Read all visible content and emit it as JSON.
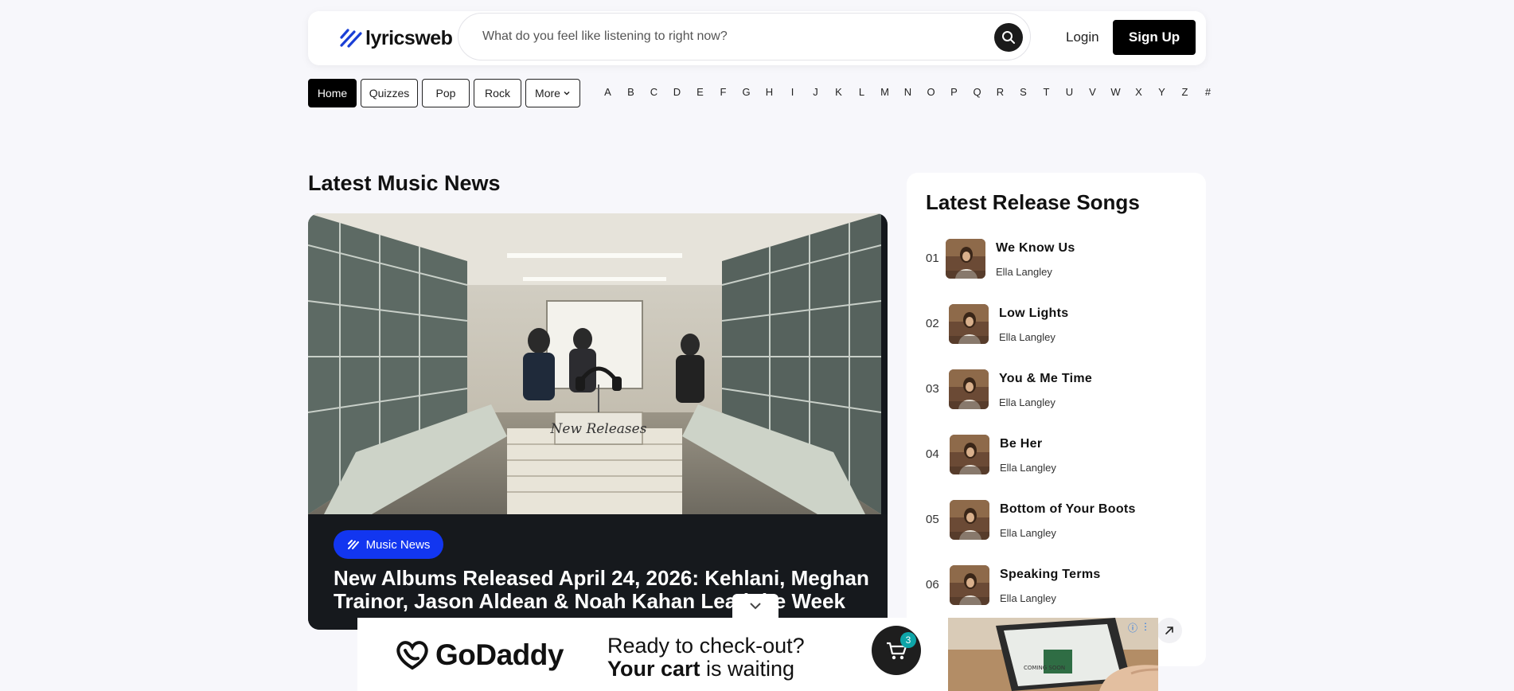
{
  "header": {
    "logo_text": "lyricsweb",
    "search_placeholder": "What do you feel like listening to right now?",
    "login_label": "Login",
    "signup_label": "Sign Up"
  },
  "nav": {
    "buttons": [
      {
        "label": "Home",
        "active": true
      },
      {
        "label": "Quizzes",
        "active": false
      },
      {
        "label": "Pop",
        "active": false
      },
      {
        "label": "Rock",
        "active": false
      },
      {
        "label": "More",
        "active": false
      }
    ],
    "alphabet": [
      "A",
      "B",
      "C",
      "D",
      "E",
      "F",
      "G",
      "H",
      "I",
      "J",
      "K",
      "L",
      "M",
      "N",
      "O",
      "P",
      "Q",
      "R",
      "S",
      "T",
      "U",
      "V",
      "W",
      "X",
      "Y",
      "Z",
      "#"
    ]
  },
  "news": {
    "section_title": "Latest Music News",
    "image_sign": "New Releases",
    "category": "Music News",
    "headline": "New Albums Released April 24, 2026: Kehlani, Meghan Trainor, Jason Aldean & Noah Kahan Lead the Week"
  },
  "songs": {
    "section_title": "Latest Release Songs",
    "items": [
      {
        "num": "01",
        "title": "We Know Us",
        "artist": "Ella Langley"
      },
      {
        "num": "02",
        "title": "Low Lights",
        "artist": "Ella Langley"
      },
      {
        "num": "03",
        "title": "You & Me Time",
        "artist": "Ella Langley"
      },
      {
        "num": "04",
        "title": "Be Her",
        "artist": "Ella Langley"
      },
      {
        "num": "05",
        "title": "Bottom of Your Boots",
        "artist": "Ella Langley"
      },
      {
        "num": "06",
        "title": "Speaking Terms",
        "artist": "Ella Langley"
      }
    ]
  },
  "ad": {
    "brand": "GoDaddy",
    "line1": "Ready to check-out?",
    "line2_bold": "Your cart",
    "line2_rest": " is waiting",
    "cart_count": "3",
    "screen_text": "COMING SOON"
  },
  "colors": {
    "accent_blue": "#1236f0",
    "logo_blue": "#1a3fd6",
    "dark": "#16191d",
    "page_bg": "#f7f7fb"
  }
}
